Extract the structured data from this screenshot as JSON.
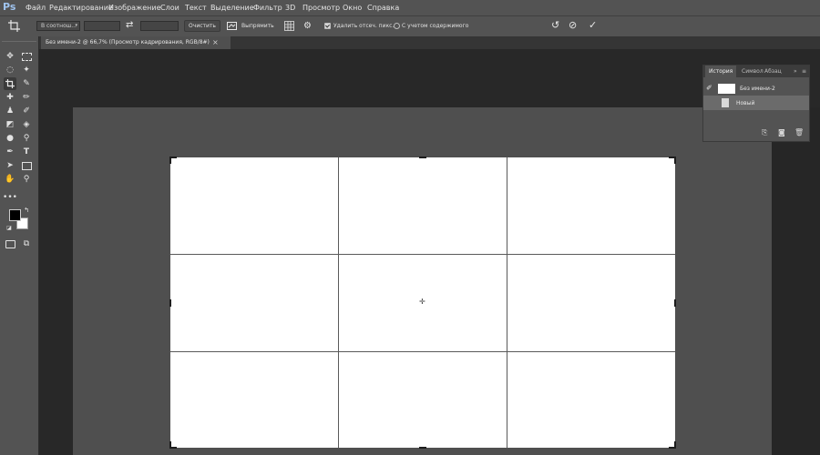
{
  "app": {
    "logo": "Ps"
  },
  "menu": {
    "items": [
      "Файл",
      "Редактирование",
      "Изображение",
      "Слои",
      "Текст",
      "Выделение",
      "Фильтр",
      "3D",
      "Просмотр",
      "Окно",
      "Справка"
    ]
  },
  "options": {
    "ratio_select": "В соотнош...",
    "crop_tool_icon": "crop-icon",
    "clear_label": "Очистить",
    "straighten_label": "Выпрямить",
    "delete_cropped_label": "Удалить отсеч. пикс.",
    "content_aware_label": "С учетом содержимого",
    "delete_cropped_checked": true,
    "content_aware_checked": false
  },
  "document": {
    "tab_title": "Без имени-2 @ 66,7% (Просмотр кадрирования, RGB/8#)",
    "close": "×"
  },
  "history_panel": {
    "tabs": [
      "История",
      "Символ",
      "Абзац"
    ],
    "collapse": "»",
    "menu": "≡",
    "snapshot_label": "Без имени-2",
    "rows": [
      {
        "label": "Новый"
      }
    ]
  },
  "colors": {
    "foreground": "#000000",
    "background": "#ffffff",
    "ui_bg": "#535353"
  }
}
